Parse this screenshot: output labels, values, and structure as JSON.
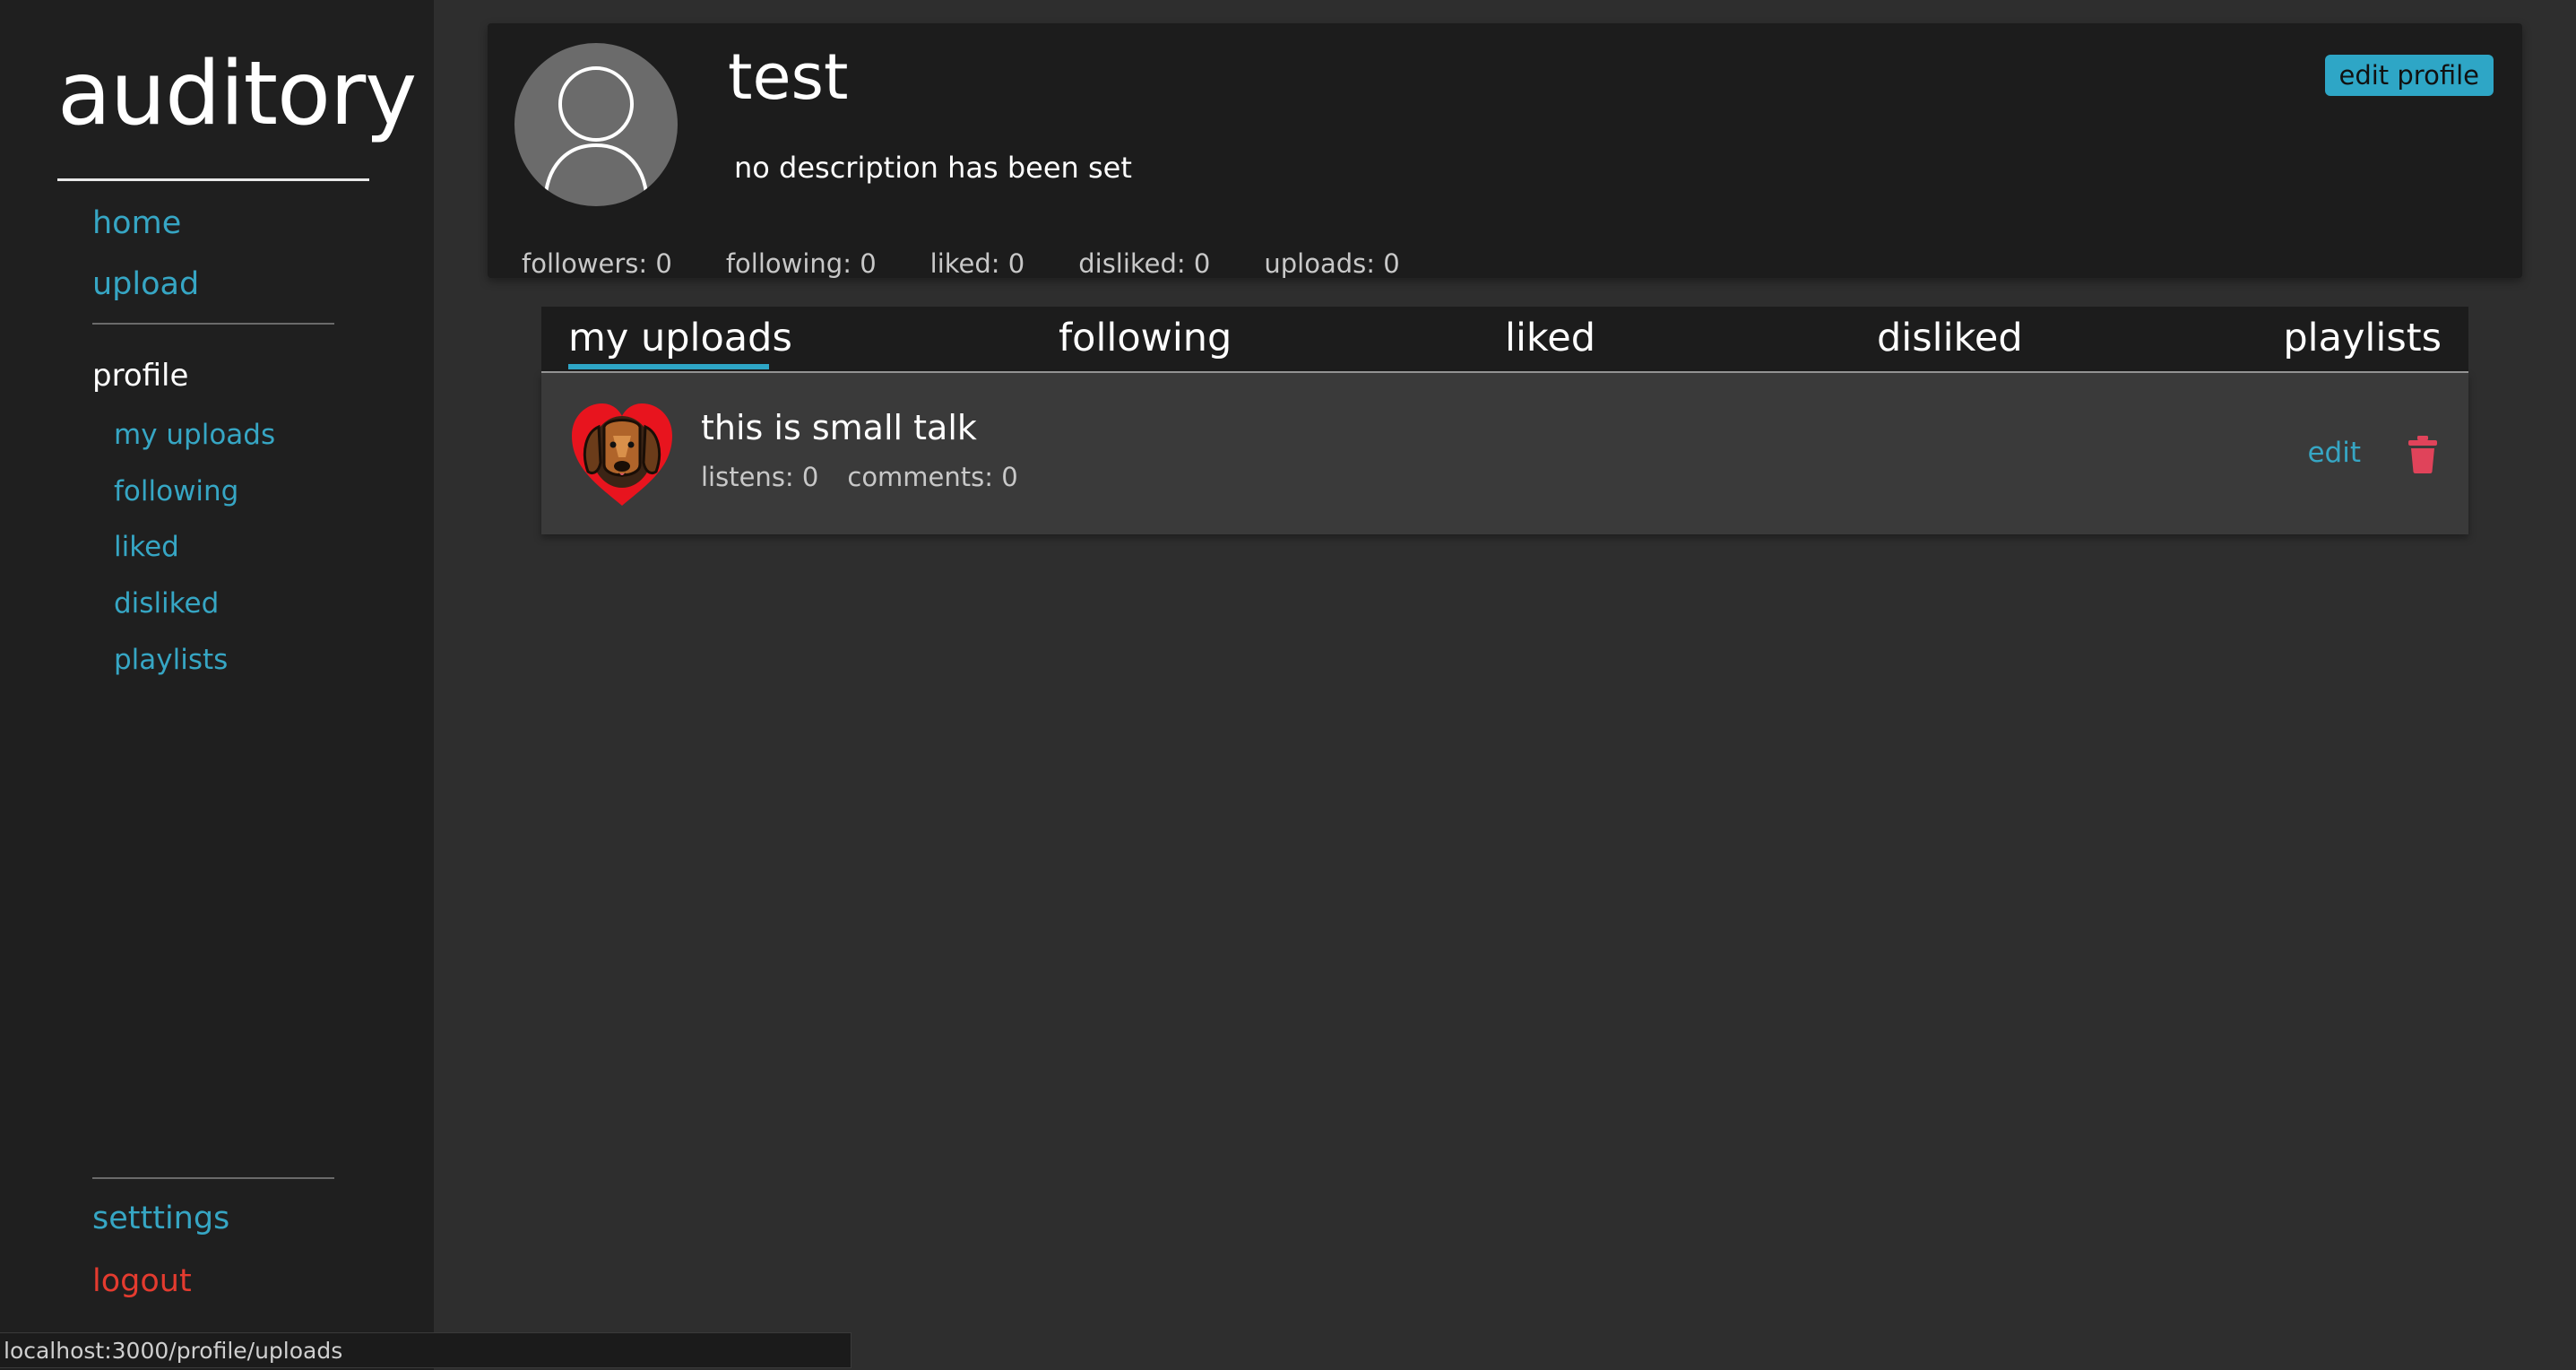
{
  "sidebar": {
    "logo": "auditory",
    "nav": {
      "home": "home",
      "upload": "upload"
    },
    "profile_heading": "profile",
    "profile_links": [
      "my uploads",
      "following",
      "liked",
      "disliked",
      "playlists"
    ],
    "settings": "setttings",
    "logout": "logout"
  },
  "profile": {
    "username": "test",
    "description": "no description has been set",
    "edit_button": "edit profile",
    "stats": [
      "followers: 0",
      "following: 0",
      "liked: 0",
      "disliked: 0",
      "uploads: 0"
    ]
  },
  "tabs": {
    "items": [
      "my uploads",
      "following",
      "liked",
      "disliked",
      "playlists"
    ],
    "active": "my uploads"
  },
  "uploads": [
    {
      "title": "this is small talk",
      "listens": "listens: 0",
      "comments": "comments: 0",
      "edit_label": "edit",
      "thumbnail_icon": "dog-heart-icon"
    }
  ],
  "status_bar": {
    "url": "localhost:3000/profile/uploads"
  },
  "colors": {
    "accent": "#2ea6c6",
    "link": "#36a6c4",
    "danger": "#e43b2f",
    "trash": "#e0435a",
    "sidebar_bg": "#1f1f1f",
    "main_bg": "#2e2e2e",
    "card_bg": "#1c1c1c"
  }
}
